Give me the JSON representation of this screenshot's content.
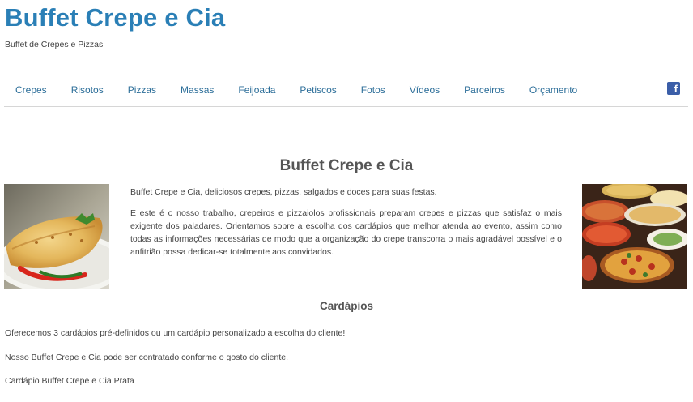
{
  "header": {
    "site_title": "Buffet Crepe e Cia",
    "tagline": "Buffet de Crepes e Pizzas"
  },
  "nav": {
    "items": [
      {
        "label": "Crepes"
      },
      {
        "label": "Risotos"
      },
      {
        "label": "Pizzas"
      },
      {
        "label": "Massas"
      },
      {
        "label": "Feijoada"
      },
      {
        "label": "Petiscos"
      },
      {
        "label": "Fotos"
      },
      {
        "label": "Vídeos"
      },
      {
        "label": "Parceiros"
      },
      {
        "label": "Orçamento"
      }
    ],
    "facebook_icon": "facebook-icon",
    "facebook_glyph": "f"
  },
  "main": {
    "title": "Buffet Crepe e Cia",
    "intro_1": "Buffet Crepe e Cia, deliciosos crepes, pizzas, salgados e doces para suas festas.",
    "intro_2": "E este é o nosso trabalho, crepeiros e pizzaiolos profissionais preparam crepes e pizzas que satisfaz o mais exigente dos paladares. Orientamos sobre a escolha dos cardápios que melhor atenda ao evento, assim como todas as informações necessárias de modo que a organização do crepe transcorra o mais agradável possível e o anfitrião possa dedicar-se totalmente aos convidados.",
    "section_title": "Cardápios",
    "line_1": "Oferecemos 3 cardápios pré-definidos ou um cardápio personalizado a escolha do cliente!",
    "line_2": "Nosso Buffet Crepe e Cia pode ser contratado conforme o gosto do cliente.",
    "line_3": "Cardápio Buffet Crepe e Cia Prata"
  },
  "colors": {
    "title_blue": "#2a7fb6",
    "nav_link": "#2c6e99",
    "facebook_blue": "#3b5ea8"
  }
}
